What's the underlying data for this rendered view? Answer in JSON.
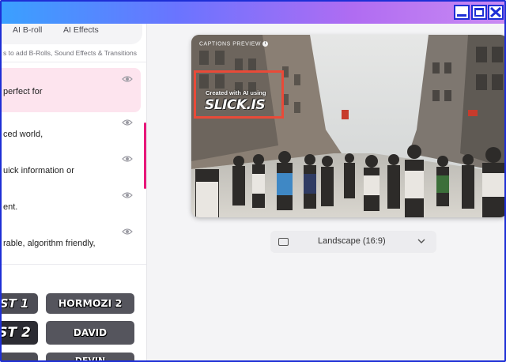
{
  "window": {
    "buttons": [
      "minimize",
      "maximize",
      "close"
    ]
  },
  "tabs": {
    "items": [
      {
        "label": "AI B-roll"
      },
      {
        "label": "AI Effects"
      }
    ]
  },
  "hint_text": "s to add B-Rolls, Sound Effects & Transitions",
  "script_lines": [
    {
      "text": "perfect for",
      "active": true
    },
    {
      "text": "ced world,",
      "active": false
    },
    {
      "text": "uick information or",
      "active": false
    },
    {
      "text": "ent.",
      "active": false
    },
    {
      "text": "rable, algorithm friendly,",
      "active": false
    }
  ],
  "caption_styles": [
    {
      "label": "ST 1"
    },
    {
      "label": "HORMOZI 2"
    },
    {
      "label": "ST 2"
    },
    {
      "label": "DAVID"
    },
    {
      "label": ""
    },
    {
      "label": "DEVIN"
    }
  ],
  "preview": {
    "label": "CAPTIONS PREVIEW",
    "watermark_line1": "Created with AI using",
    "watermark_line2": "SLICK.IS",
    "accent": "#e94a38"
  },
  "aspect_dropdown": {
    "value": "Landscape (16:9)"
  },
  "colors": {
    "accent": "#e8187a",
    "frame": "#1e2fd6",
    "active_row": "#fde4ee"
  }
}
